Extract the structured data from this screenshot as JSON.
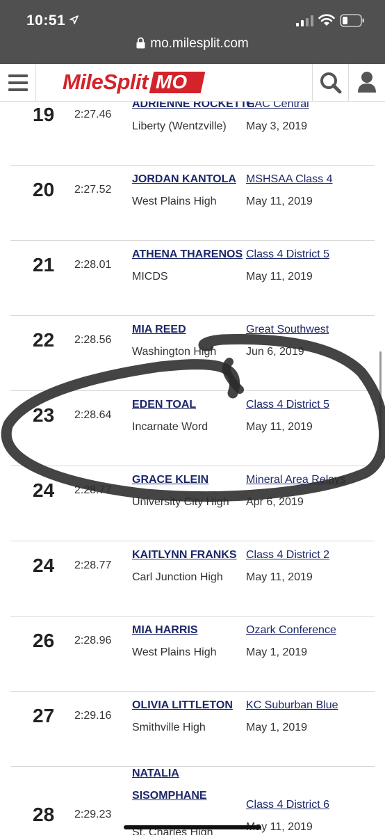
{
  "status": {
    "time": "10:51"
  },
  "browser": {
    "url": "mo.milesplit.com"
  },
  "header": {
    "logo_main": "MileSplit",
    "logo_state": "MO"
  },
  "rankings": [
    {
      "rank": "19",
      "mark": "2:27.46",
      "athlete": "ADRIENNE ROCKETTE",
      "team": "Liberty (Wentzville)",
      "meet": "GAC Central",
      "date": "May 3, 2019"
    },
    {
      "rank": "20",
      "mark": "2:27.52",
      "athlete": "JORDAN KANTOLA",
      "team": "West Plains High",
      "meet": "MSHSAA Class 4",
      "date": "May 11, 2019"
    },
    {
      "rank": "21",
      "mark": "2:28.01",
      "athlete": "ATHENA THARENOS",
      "team": "MICDS",
      "meet": "Class 4 District 5",
      "date": "May 11, 2019"
    },
    {
      "rank": "22",
      "mark": "2:28.56",
      "athlete": "MIA REED",
      "team": "Washington High",
      "meet": "Great Southwest",
      "date": "Jun 6, 2019"
    },
    {
      "rank": "23",
      "mark": "2:28.64",
      "athlete": "EDEN TOAL",
      "team": "Incarnate Word",
      "meet": "Class 4 District 5",
      "date": "May 11, 2019"
    },
    {
      "rank": "24",
      "mark": "2:28.77",
      "athlete": "GRACE KLEIN",
      "team": "University City High",
      "meet": "Mineral Area Relays",
      "date": "Apr 6, 2019"
    },
    {
      "rank": "24",
      "mark": "2:28.77",
      "athlete": "KAITLYNN FRANKS",
      "team": "Carl Junction High",
      "meet": "Class 4 District 2",
      "date": "May 11, 2019"
    },
    {
      "rank": "26",
      "mark": "2:28.96",
      "athlete": "MIA HARRIS",
      "team": "West Plains High",
      "meet": "Ozark Conference",
      "date": "May 1, 2019"
    },
    {
      "rank": "27",
      "mark": "2:29.16",
      "athlete": "OLIVIA LITTLETON",
      "team": "Smithville High",
      "meet": "KC Suburban Blue",
      "date": "May 1, 2019"
    },
    {
      "rank": "28",
      "mark": "2:29.23",
      "athlete": "NATALIA SISOMPHANE",
      "team": "St. Charles High",
      "meet": "Class 4 District 6",
      "date": "May 11, 2019"
    }
  ],
  "colors": {
    "statusbar": "#505050",
    "brand_red": "#d3232b",
    "link_navy": "#1c2769",
    "scribble": "#2a2a2a"
  },
  "icons": {
    "menu": "menu-icon",
    "search": "search-icon",
    "user": "user-icon",
    "lock": "lock-icon"
  }
}
